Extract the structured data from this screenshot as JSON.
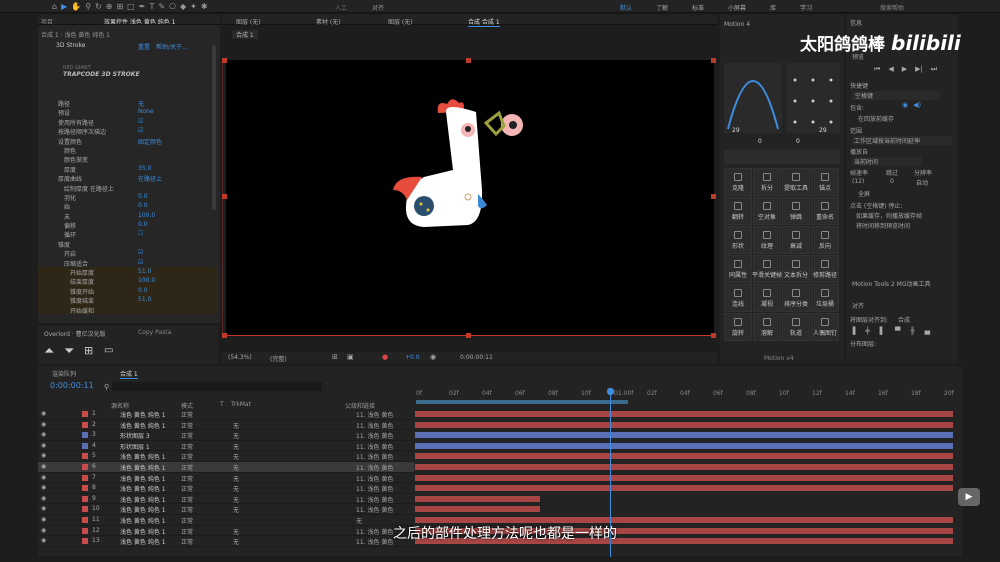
{
  "topbar": {
    "zoom_label": "人工",
    "align_label": "对齐",
    "workspace_items": [
      "默认",
      "了解",
      "标准",
      "小屏幕",
      "库",
      "学习"
    ],
    "search": "搜索帮助"
  },
  "effects_panel": {
    "tab_project": "项目",
    "tab_effects": "效果控件 浅色 黄色 纯色 1",
    "breadcrumb": "合成 1 · 浅色 黄色 纯色 1",
    "plugin_name": "3D Stroke",
    "reset": "重置",
    "about": "帮助/关于...",
    "logo_line1": "RED GIANT",
    "logo_line2": "TRAPCODE 3D STROKE",
    "rows": [
      {
        "label": "路径",
        "value": "无",
        "indent": 0
      },
      {
        "label": "预设",
        "value": "None",
        "indent": 0
      },
      {
        "label": "使用所有路径",
        "value": "☑",
        "indent": 0
      },
      {
        "label": "按路径顺序次描边",
        "value": "☑",
        "indent": 0
      },
      {
        "label": "设置颜色",
        "value": "固定颜色",
        "indent": 0
      },
      {
        "label": "颜色",
        "value": "",
        "indent": 1
      },
      {
        "label": "颜色渐变",
        "value": "",
        "indent": 1
      },
      {
        "label": "厚度",
        "value": "35.0",
        "indent": 1
      },
      {
        "label": "厚度曲线",
        "value": "在路径上",
        "indent": 0
      },
      {
        "label": "绘制厚度 在路径上",
        "value": "",
        "indent": 1
      },
      {
        "label": "羽化",
        "value": "0.0",
        "indent": 1
      },
      {
        "label": "始",
        "value": "0.0",
        "indent": 1
      },
      {
        "label": "末",
        "value": "100.0",
        "indent": 1
      },
      {
        "label": "偏移",
        "value": "0.0",
        "indent": 1
      },
      {
        "label": "循环",
        "value": "☐",
        "indent": 1
      },
      {
        "label": "锥度",
        "value": "",
        "indent": 0
      },
      {
        "label": "开启",
        "value": "☑",
        "indent": 1
      },
      {
        "label": "压缩适合",
        "value": "☑",
        "indent": 1
      },
      {
        "label": "开始厚度",
        "value": "51.0",
        "indent": 2
      },
      {
        "label": "结束厚度",
        "value": "100.0",
        "indent": 2
      },
      {
        "label": "锥度开始",
        "value": "0.0",
        "indent": 2
      },
      {
        "label": "锥度结束",
        "value": "51.0",
        "indent": 2
      },
      {
        "label": "开始缓和",
        "value": "",
        "indent": 2
      }
    ]
  },
  "overlord": {
    "tab1": "Overlord · 曹亿汉化版",
    "tab2": "Copy Pasta"
  },
  "viewer": {
    "tab_layer": "图层 (无)",
    "tab_footage": "素材 (无)",
    "tab_layer2": "图层 (无)",
    "tab_comp": "合成 合成 1",
    "comp_breadcrumb": "合成 1",
    "zoom": "(54.3%)",
    "quality": "(完整)",
    "exposure": "+0.0",
    "timecode": "0:00:00:11"
  },
  "motion": {
    "title": "Motion 4",
    "left_value": "29",
    "right_value": "29",
    "mid_a": "0",
    "mid_b": "0",
    "buttons": [
      "克隆",
      "拆分",
      "提取工具",
      "锚点",
      "翻转",
      "空对象",
      "弹跳",
      "重命名",
      "形状",
      "纹理",
      "衰减",
      "反向",
      "同属性",
      "平滑关键帧",
      "文本拆分",
      "修剪路径",
      "连线",
      "凝视",
      "排序分类",
      "垃圾桶",
      "旋转",
      "溶解",
      "轨道",
      "人偶图钉"
    ],
    "footer": "Motion v4"
  },
  "right_panel": {
    "title": "信息",
    "preview": "预览",
    "shortcut_label": "快捷键",
    "shortcut_value": "空格键",
    "include": "包含:",
    "cache_before": "在回放前缓存",
    "range_label": "范围",
    "range_value": "工作区域按当前时间延伸",
    "play_from": "播放自",
    "play_from_value": "当前时间",
    "fps_label": "帧速率",
    "skip_label": "跳过",
    "res_label": "分辨率",
    "fps_value": "(12)",
    "skip_value": "0",
    "res_value": "自动",
    "fullscreen": "全屏",
    "stop_label": "点击 (空格键) 停止:",
    "opt1": "如果缓存，则播放缓存帧",
    "opt2": "将时间移到预览时间",
    "motion_tools": "Motion Tools 2 MG动画工具",
    "align_title": "对齐",
    "align_to": "将图层对齐到:",
    "align_to_value": "合成",
    "distribute": "分布图层:"
  },
  "watermark": {
    "text": "太阳鸽鸽棒",
    "logo": "bilibili"
  },
  "timeline": {
    "tab_render": "渲染队列",
    "tab_comp": "合成 1",
    "timecode": "0:00:00:11",
    "col_name": "源名称",
    "col_mode": "模式",
    "col_t": "T",
    "col_trkmat": "TrkMat",
    "col_parent": "父级和链接",
    "ruler": [
      "0f",
      "02f",
      "04f",
      "06f",
      "08f",
      "10f",
      "01:00f",
      "02f",
      "04f",
      "06f",
      "08f",
      "10f",
      "12f",
      "14f",
      "16f",
      "18f",
      "20f"
    ],
    "layers": [
      {
        "num": "1",
        "name": "浅色 黄色 纯色 1",
        "color": "#c84c4c",
        "mode": "正常",
        "trk": "",
        "parent": "11. 浅色 黄色"
      },
      {
        "num": "2",
        "name": "浅色 黄色 纯色 1",
        "color": "#c84c4c",
        "mode": "正常",
        "trk": "无",
        "parent": "11. 浅色 黄色"
      },
      {
        "num": "3",
        "name": "形状图层 3",
        "color": "#5a6fb5",
        "mode": "正常",
        "trk": "无",
        "parent": "11. 浅色 黄色"
      },
      {
        "num": "4",
        "name": "形状图层 1",
        "color": "#5a6fb5",
        "mode": "正常",
        "trk": "无",
        "parent": "11. 浅色 黄色"
      },
      {
        "num": "5",
        "name": "浅色 黄色 纯色 1",
        "color": "#c84c4c",
        "mode": "正常",
        "trk": "无",
        "parent": "11. 浅色 黄色"
      },
      {
        "num": "6",
        "name": "浅色 黄色 纯色 1",
        "color": "#c84c4c",
        "mode": "正常",
        "trk": "无",
        "parent": "11. 浅色 黄色"
      },
      {
        "num": "7",
        "name": "浅色 黄色 纯色 1",
        "color": "#c84c4c",
        "mode": "正常",
        "trk": "无",
        "parent": "11. 浅色 黄色"
      },
      {
        "num": "8",
        "name": "浅色 黄色 纯色 1",
        "color": "#c84c4c",
        "mode": "正常",
        "trk": "无",
        "parent": "11. 浅色 黄色"
      },
      {
        "num": "9",
        "name": "浅色 黄色 纯色 1",
        "color": "#c84c4c",
        "mode": "正常",
        "trk": "无",
        "parent": "11. 浅色 黄色"
      },
      {
        "num": "10",
        "name": "浅色 黄色 纯色 1",
        "color": "#c84c4c",
        "mode": "正常",
        "trk": "无",
        "parent": "11. 浅色 黄色"
      },
      {
        "num": "11",
        "name": "浅色 黄色 纯色 1",
        "color": "#c84c4c",
        "mode": "正常",
        "trk": "",
        "parent": "无"
      },
      {
        "num": "12",
        "name": "浅色 黄色 纯色 1",
        "color": "#c84c4c",
        "mode": "正常",
        "trk": "无",
        "parent": "11. 浅色 黄色"
      },
      {
        "num": "13",
        "name": "浅色 黄色 纯色 1",
        "color": "#c84c4c",
        "mode": "正常",
        "trk": "无",
        "parent": "11. 浅色 黄色"
      }
    ]
  },
  "subtitle": "之后的部件处理方法呢也都是一样的"
}
